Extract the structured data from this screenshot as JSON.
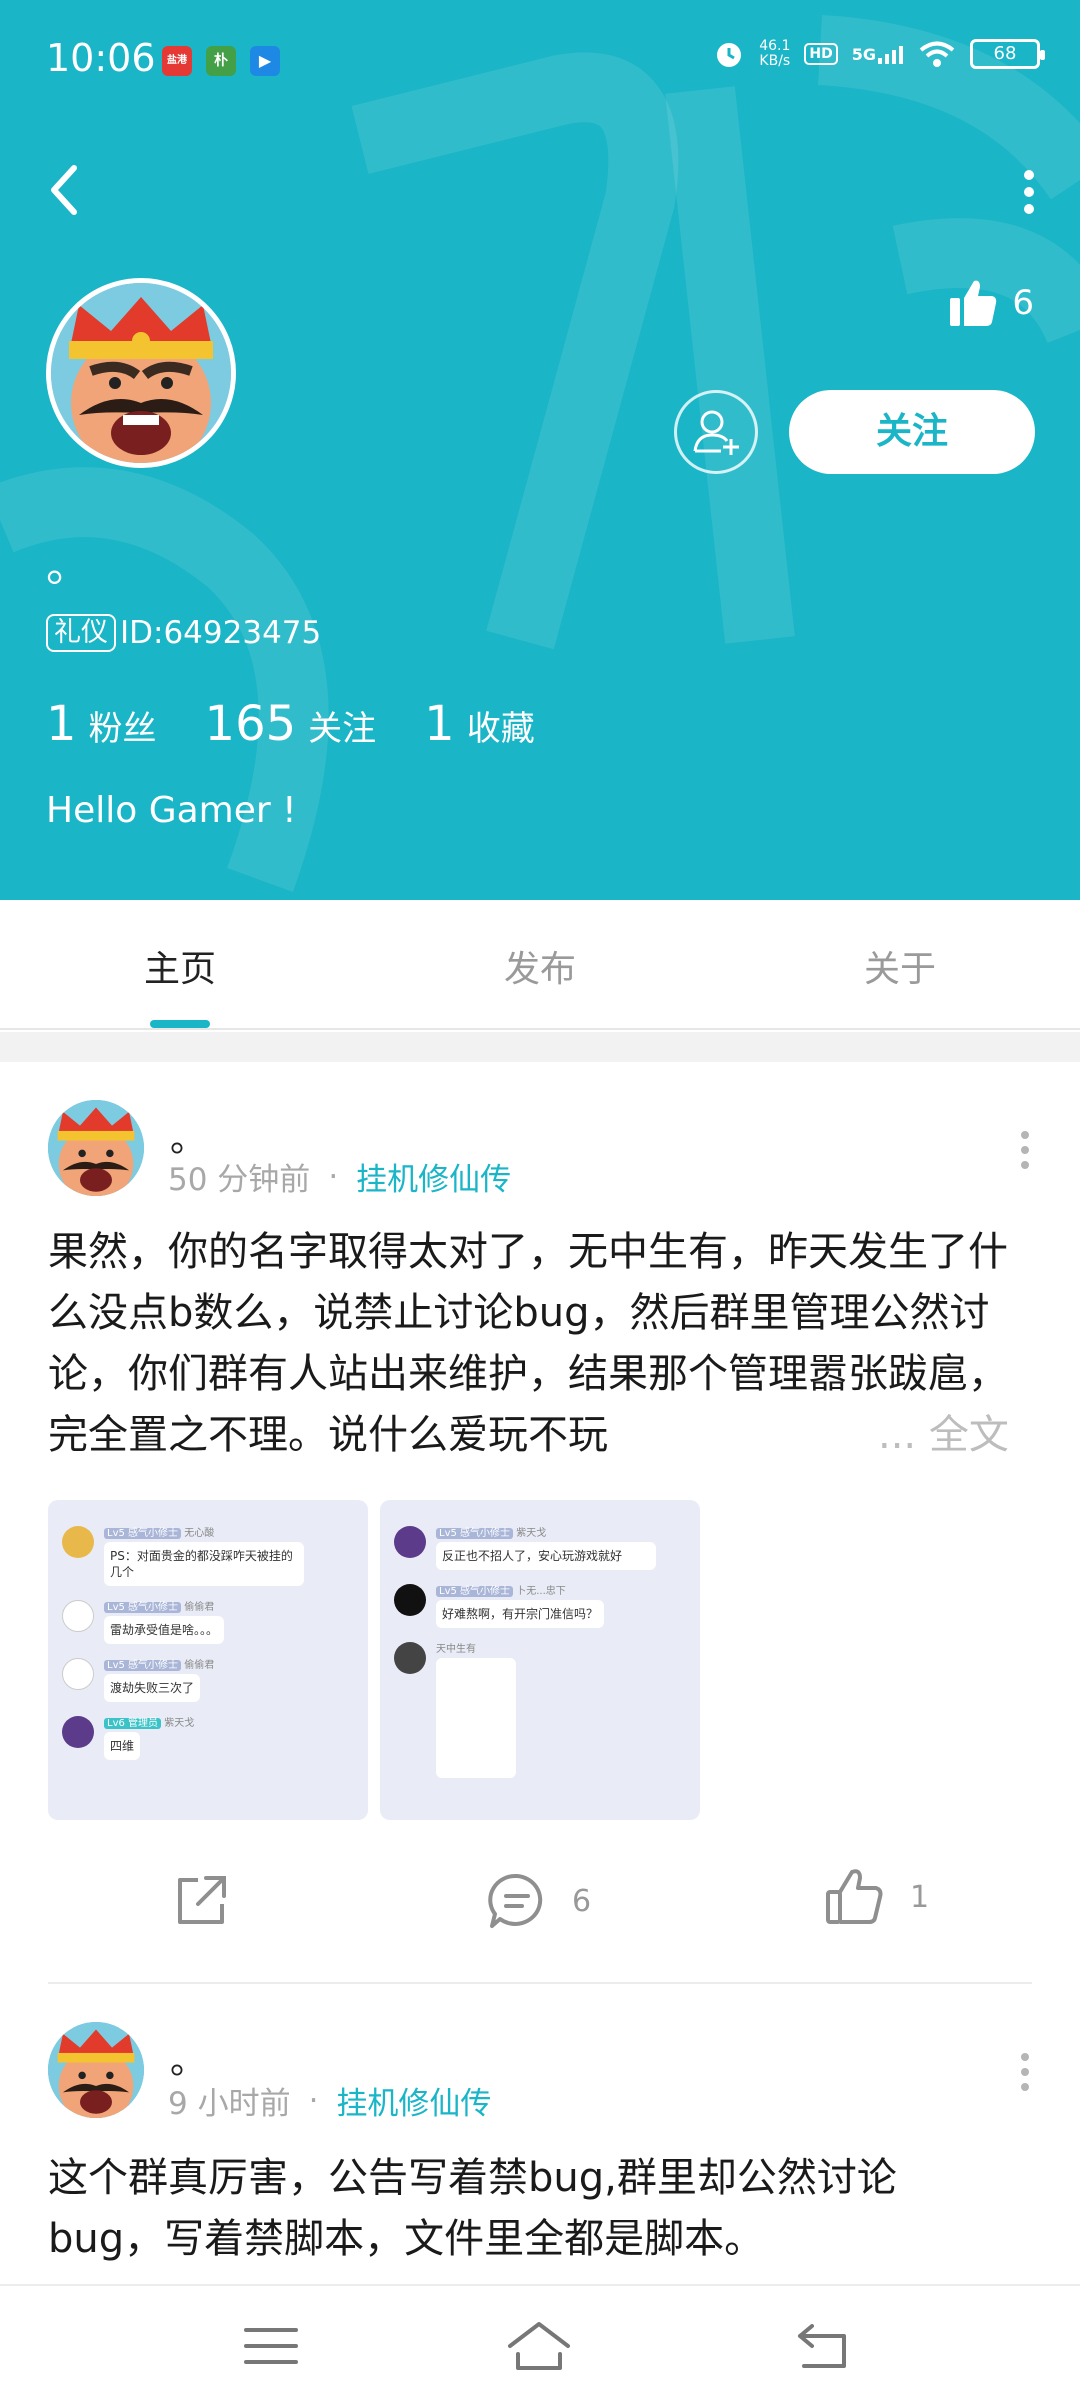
{
  "status_bar": {
    "time": "10:06",
    "app_icons": [
      {
        "name": "news-app-icon",
        "label": "盐港",
        "color": "#e53935"
      },
      {
        "name": "puzi-app-icon",
        "label": "朴",
        "color": "#43a047"
      },
      {
        "name": "video-app-icon",
        "label": "▶",
        "color": "#1e88e5"
      }
    ],
    "net_speed_value": "46.1",
    "net_speed_unit": "KB/s",
    "hd": "HD",
    "network": "5G",
    "battery": "68"
  },
  "profile": {
    "likes": "6",
    "follow_label": "关注",
    "nickname": "。",
    "badge": "礼仪",
    "user_id": "ID:64923475",
    "followers_count": "1",
    "followers_label": "粉丝",
    "following_count": "165",
    "following_label": "关注",
    "favorites_count": "1",
    "favorites_label": "收藏",
    "bio": "Hello Gamer !"
  },
  "tabs": [
    {
      "label": "主页",
      "active": true
    },
    {
      "label": "发布",
      "active": false
    },
    {
      "label": "关于",
      "active": false
    }
  ],
  "posts": [
    {
      "author": "。",
      "time": "50 分钟前",
      "dot": "·",
      "game": "挂机修仙传",
      "text": "果然，你的名字取得太对了，无中生有，昨天发生了什么没点b数么，说禁止讨论bug，然后群里管理公然讨论，你们群有人站出来维护，结果那个管理嚣张跋扈，完全置之不理。说什么爱玩不玩",
      "more": "... 全文",
      "images": [
        {
          "messages": [
            {
              "tag": "Lv5 感气小修士",
              "name": "无心酸",
              "text": "PS：对面贵金的都没踩咋天被挂的几个"
            },
            {
              "tag": "Lv5 感气小修士",
              "name": "偷偷君",
              "text": "雷劫承受值是啥。。。"
            },
            {
              "tag": "Lv5 感气小修士",
              "name": "偷偷君",
              "text": "渡劫失败三次了"
            },
            {
              "tag": "Lv6 管理员",
              "name": "紫天戈",
              "text": "四维"
            }
          ]
        },
        {
          "messages": [
            {
              "tag": "Lv5 感气小修士",
              "name": "紫天戈",
              "text": "反正也不招人了，安心玩游戏就好"
            },
            {
              "tag": "Lv5 感气小修士",
              "name": "卜无...忠下",
              "text": "好难熬啊，有开宗门准信吗？"
            },
            {
              "tag": "",
              "name": "天中生有",
              "text": ""
            }
          ]
        }
      ],
      "share_label": "",
      "comments": "6",
      "likes": "1"
    },
    {
      "author": "。",
      "time": "9 小时前",
      "dot": "·",
      "game": "挂机修仙传",
      "text": "这个群真厉害，公告写着禁bug,群里却公然讨论bug，写着禁脚本，文件里全都是脚本。"
    }
  ]
}
